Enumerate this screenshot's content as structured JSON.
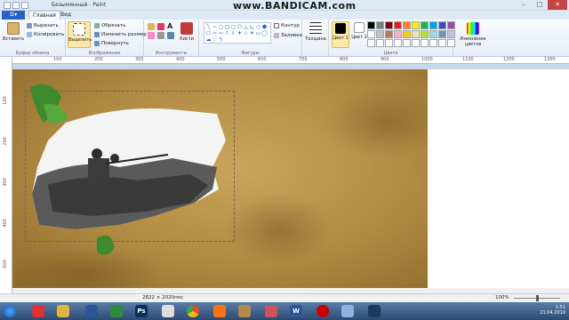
{
  "window": {
    "title": "Безымянный - Paint",
    "watermark": "www.BANDICAM.com"
  },
  "tabs": [
    "Главная",
    "Вид"
  ],
  "ribbon": {
    "paste": "Вставить",
    "cut": "Вырезать",
    "copy": "Копировать",
    "select": "Выделить",
    "crop": "Обрезать",
    "resize": "Изменить размер",
    "rotate": "Повернуть",
    "brushes": "Кисти",
    "outline": "Контур",
    "fill": "Заливка",
    "thickness": "Толщина",
    "color1": "Цвет 1",
    "color2": "Цвет 2",
    "edit_colors": "Изменение цветов",
    "groups": {
      "clipboard": "Буфер обмена",
      "image": "Изображение",
      "tools": "Инструменты",
      "shapes": "Фигуры",
      "colors": "Цвета"
    }
  },
  "palette": [
    "#000000",
    "#7f7f7f",
    "#880015",
    "#ed1c24",
    "#ff7f27",
    "#fff200",
    "#22b14c",
    "#00a2e8",
    "#3f48cc",
    "#a349a4",
    "#ffffff",
    "#c3c3c3",
    "#b97a57",
    "#ffaec9",
    "#ffc90e",
    "#efe4b0",
    "#b5e61d",
    "#99d9ea",
    "#7092be",
    "#c8bfe7",
    "#ffffff",
    "#ffffff",
    "#ffffff",
    "#ffffff",
    "#ffffff",
    "#ffffff",
    "#ffffff",
    "#ffffff",
    "#ffffff",
    "#ffffff"
  ],
  "rulers": {
    "h": [
      "100",
      "200",
      "300",
      "400",
      "500",
      "600",
      "700",
      "800",
      "900",
      "1000",
      "1100",
      "1200",
      "1300"
    ],
    "v": [
      "100",
      "200",
      "300",
      "400",
      "500"
    ]
  },
  "status": {
    "size": "2822 × 2020пкс",
    "zoom": "100%"
  },
  "clock": {
    "time": "1:51",
    "date": "21.04.2019"
  }
}
